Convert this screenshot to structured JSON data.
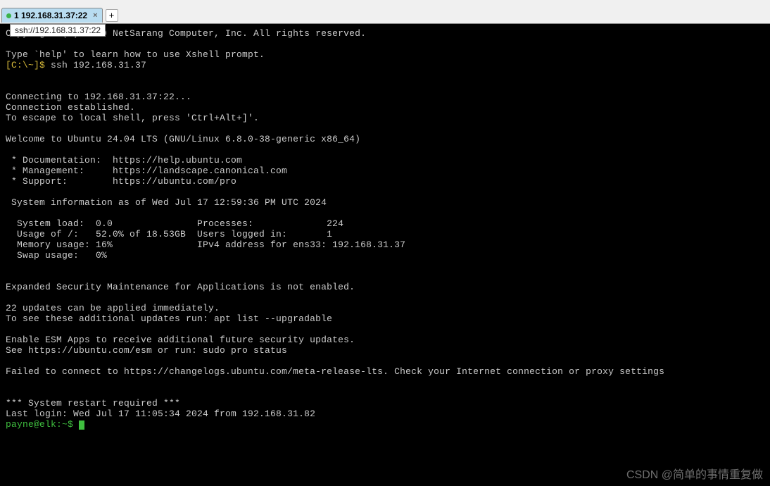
{
  "title_bar": "",
  "tab": {
    "label": "1 192.168.31.37:22",
    "close": "×"
  },
  "add_tab": "+",
  "tooltip": "ssh://192.168.31.37:22",
  "term": {
    "copyright": "Copyright (c) 2020 NetSarang Computer, Inc. All rights reserved.",
    "help_line": "Type `help' to learn how to use Xshell prompt.",
    "prompt1": "[C:\\~]$ ",
    "cmd1": "ssh 192.168.31.37",
    "connecting": "Connecting to 192.168.31.37:22...",
    "established": "Connection established.",
    "escape": "To escape to local shell, press 'Ctrl+Alt+]'.",
    "welcome": "Welcome to Ubuntu 24.04 LTS (GNU/Linux 6.8.0-38-generic x86_64)",
    "doc": " * Documentation:  https://help.ubuntu.com",
    "mgmt": " * Management:     https://landscape.canonical.com",
    "support": " * Support:        https://ubuntu.com/pro",
    "sysinfo": " System information as of Wed Jul 17 12:59:36 PM UTC 2024",
    "row1": "  System load:  0.0               Processes:             224",
    "row2": "  Usage of /:   52.0% of 18.53GB  Users logged in:       1",
    "row3": "  Memory usage: 16%               IPv4 address for ens33: 192.168.31.37",
    "row4": "  Swap usage:   0%",
    "esm": "Expanded Security Maintenance for Applications is not enabled.",
    "updates": "22 updates can be applied immediately.",
    "updates2": "To see these additional updates run: apt list --upgradable",
    "enable_esm": "Enable ESM Apps to receive additional future security updates.",
    "see_esm": "See https://ubuntu.com/esm or run: sudo pro status",
    "failed": "Failed to connect to https://changelogs.ubuntu.com/meta-release-lts. Check your Internet connection or proxy settings",
    "restart": "*** System restart required ***",
    "lastlogin": "Last login: Wed Jul 17 11:05:34 2024 from 192.168.31.82",
    "shell_prompt": "payne@elk:~$ "
  },
  "watermark": "CSDN @简单的事情重复做"
}
